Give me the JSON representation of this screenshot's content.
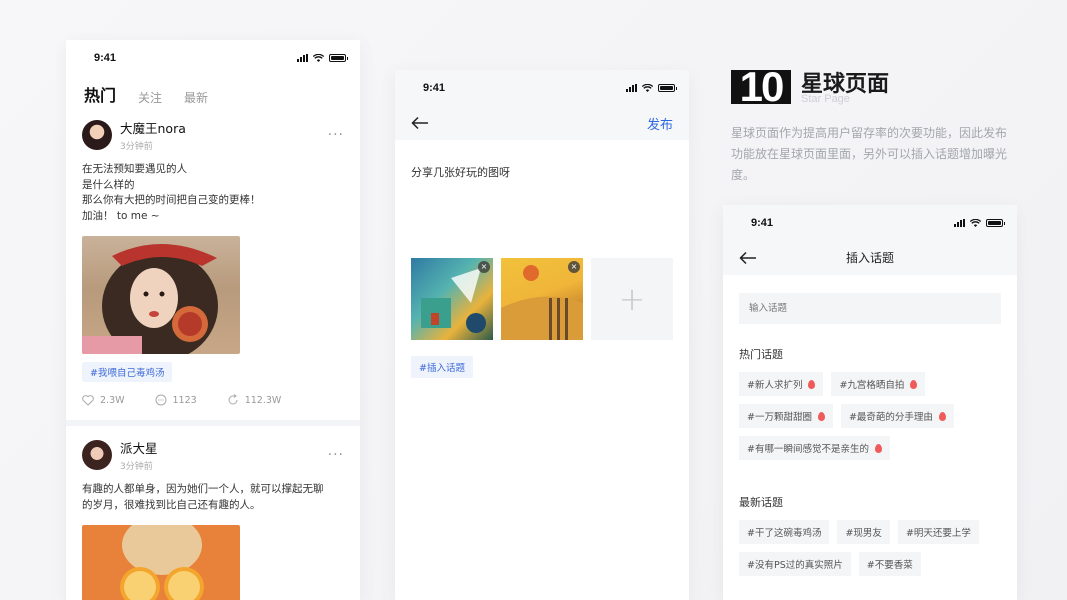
{
  "status_time": "9:41",
  "feed": {
    "tabs": [
      "热门",
      "关注",
      "最新"
    ],
    "posts": [
      {
        "name": "大魔王nora",
        "time": "3分钟前",
        "lines": [
          "在无法预知要遇见的人",
          "是什么样的",
          "那么你有大把的时间把自己变的更棒！",
          "加油！ to me ~"
        ],
        "topic": "#我喂自己毒鸡汤",
        "likes": "2.3W",
        "comments": "1123",
        "shares": "112.3W"
      },
      {
        "name": "派大星",
        "time": "3分钟前",
        "lines": [
          "有趣的人都单身，因为她们一个人，就可以撑起无聊",
          "的岁月，很难找到比自己还有趣的人。"
        ]
      }
    ]
  },
  "publish": {
    "publish_label": "发布",
    "content": "分享几张好玩的图呀",
    "topic": "#插入话题"
  },
  "section": {
    "number": "10",
    "title": "星球页面",
    "subtitle": "Star Page",
    "description": "星球页面作为提高用户留存率的次要功能，因此发布功能放在星球页面里面，另外可以插入话题增加曝光度。"
  },
  "insert_topic": {
    "title": "插入话题",
    "search_placeholder": "输入话题",
    "hot_title": "热门话题",
    "hot_topics": [
      "#新人求扩列",
      "#九宫格晒自拍",
      "#一万颗甜甜圈",
      "#最奇葩的分手理由",
      "#有哪一瞬间感觉不是亲生的"
    ],
    "new_title": "最新话题",
    "new_topics": [
      "#干了这碗毒鸡汤",
      "#现男友",
      "#明天还要上学",
      "#没有PS过的真实照片",
      "#不要香菜"
    ]
  },
  "colors": {
    "accent": "#2f68e0",
    "topic_bg": "#eef3fc",
    "fire": "#ef5a5a"
  }
}
